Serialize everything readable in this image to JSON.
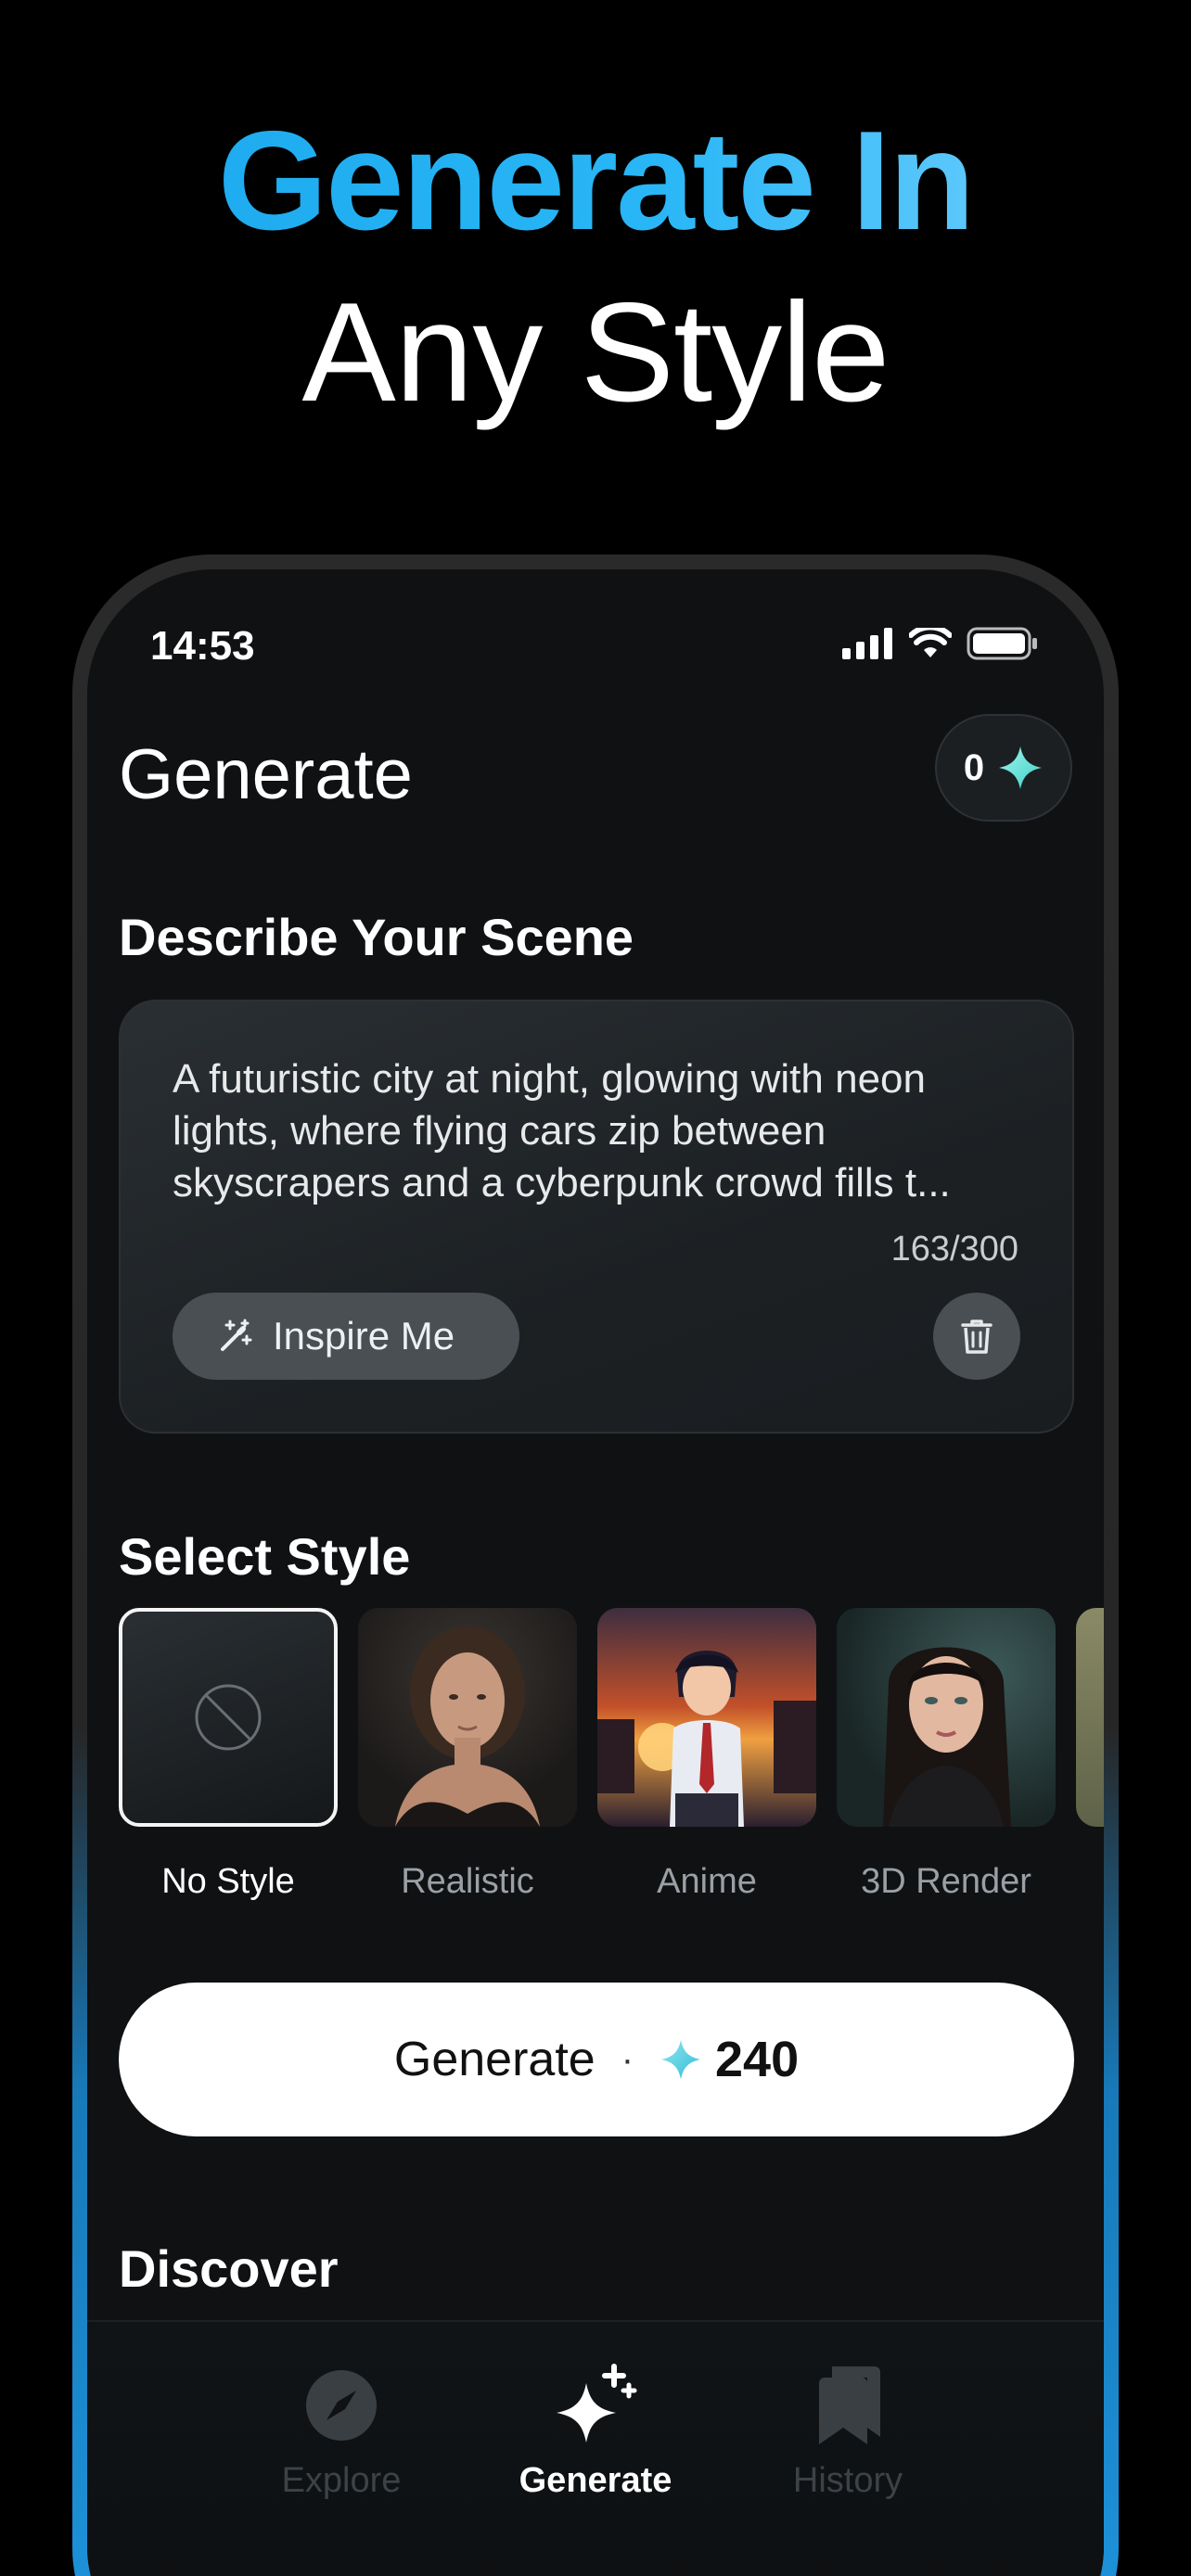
{
  "hero": {
    "line1": "Generate In",
    "line2": "Any Style"
  },
  "status_bar": {
    "time": "14:53"
  },
  "header": {
    "title": "Generate",
    "credits": "0"
  },
  "prompt": {
    "section_title": "Describe Your Scene",
    "text": "A futuristic city at night, glowing with neon lights, where flying cars zip between skyscrapers and a cyberpunk crowd fills t...",
    "char_count": "163/300",
    "inspire_label": "Inspire Me"
  },
  "styles": {
    "section_title": "Select Style",
    "items": [
      {
        "label": "No Style",
        "selected": true
      },
      {
        "label": "Realistic",
        "selected": false
      },
      {
        "label": "Anime",
        "selected": false
      },
      {
        "label": "3D Render",
        "selected": false
      }
    ]
  },
  "generate_button": {
    "label": "Generate",
    "separator": "·",
    "cost": "240"
  },
  "discover": {
    "section_title": "Discover"
  },
  "tabbar": {
    "items": [
      {
        "label": "Explore",
        "icon": "compass-icon"
      },
      {
        "label": "Generate",
        "icon": "sparkles-icon",
        "active": true
      },
      {
        "label": "History",
        "icon": "bookmarks-icon"
      }
    ]
  },
  "colors": {
    "accent": "#1aa7ec",
    "gem": "#5fe0d8",
    "background": "#000000",
    "screen": "#0f1113"
  }
}
